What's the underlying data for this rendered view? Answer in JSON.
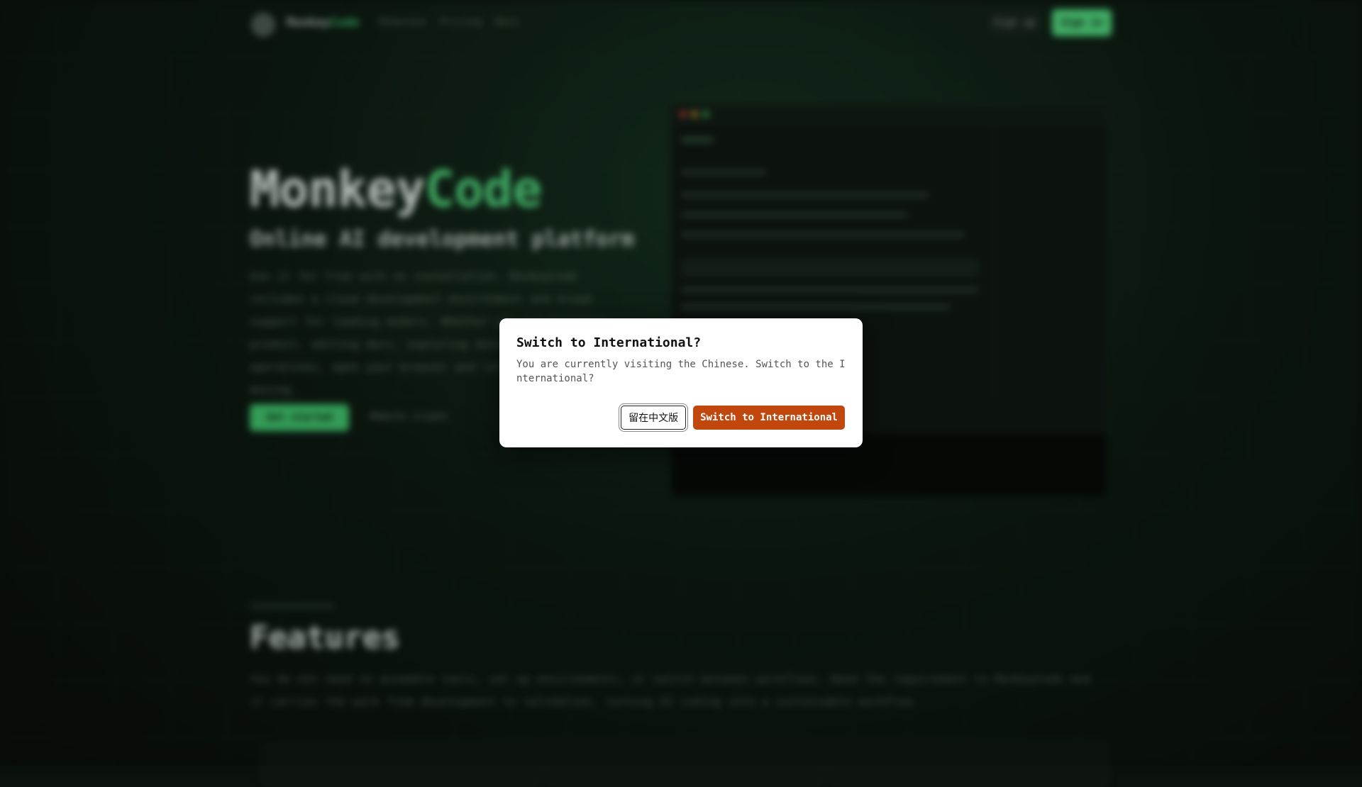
{
  "background_page": {
    "brand": {
      "part1": "Monkey",
      "part2": "Code"
    },
    "nav": [
      "Showcase",
      "Pricing",
      "Docs"
    ],
    "auth": {
      "sign_up": "Sign up",
      "sign_in": "Sign in"
    },
    "hero": {
      "title_part1": "Monkey",
      "title_part2": "Code",
      "subtitle": "Online AI development platform",
      "description": "Use it for free with no installation. MonkeyCode includes a cloud development environment and broad support for leading models. Whether you are building product, editing docs, exploring data, or handling operations, open your browser and let AI keep the work moving.",
      "cta_primary": "Get started",
      "cta_secondary": "Mobile client"
    },
    "features": {
      "title": "Features",
      "description": "You do not need to assemble tools, set up environments, or switch between workflows. Hand the requirement to MonkeyCode and it carries the work from development to validation, turning AI coding into a sustainable workflow."
    }
  },
  "dialog": {
    "title": "Switch to International?",
    "message": "You are currently visiting the Chinese. Switch to the International?",
    "stay_button": "留在中文版",
    "switch_button": "Switch to International"
  },
  "colors": {
    "accent_green": "#4fd27b",
    "switch_button": "#c2470c"
  }
}
